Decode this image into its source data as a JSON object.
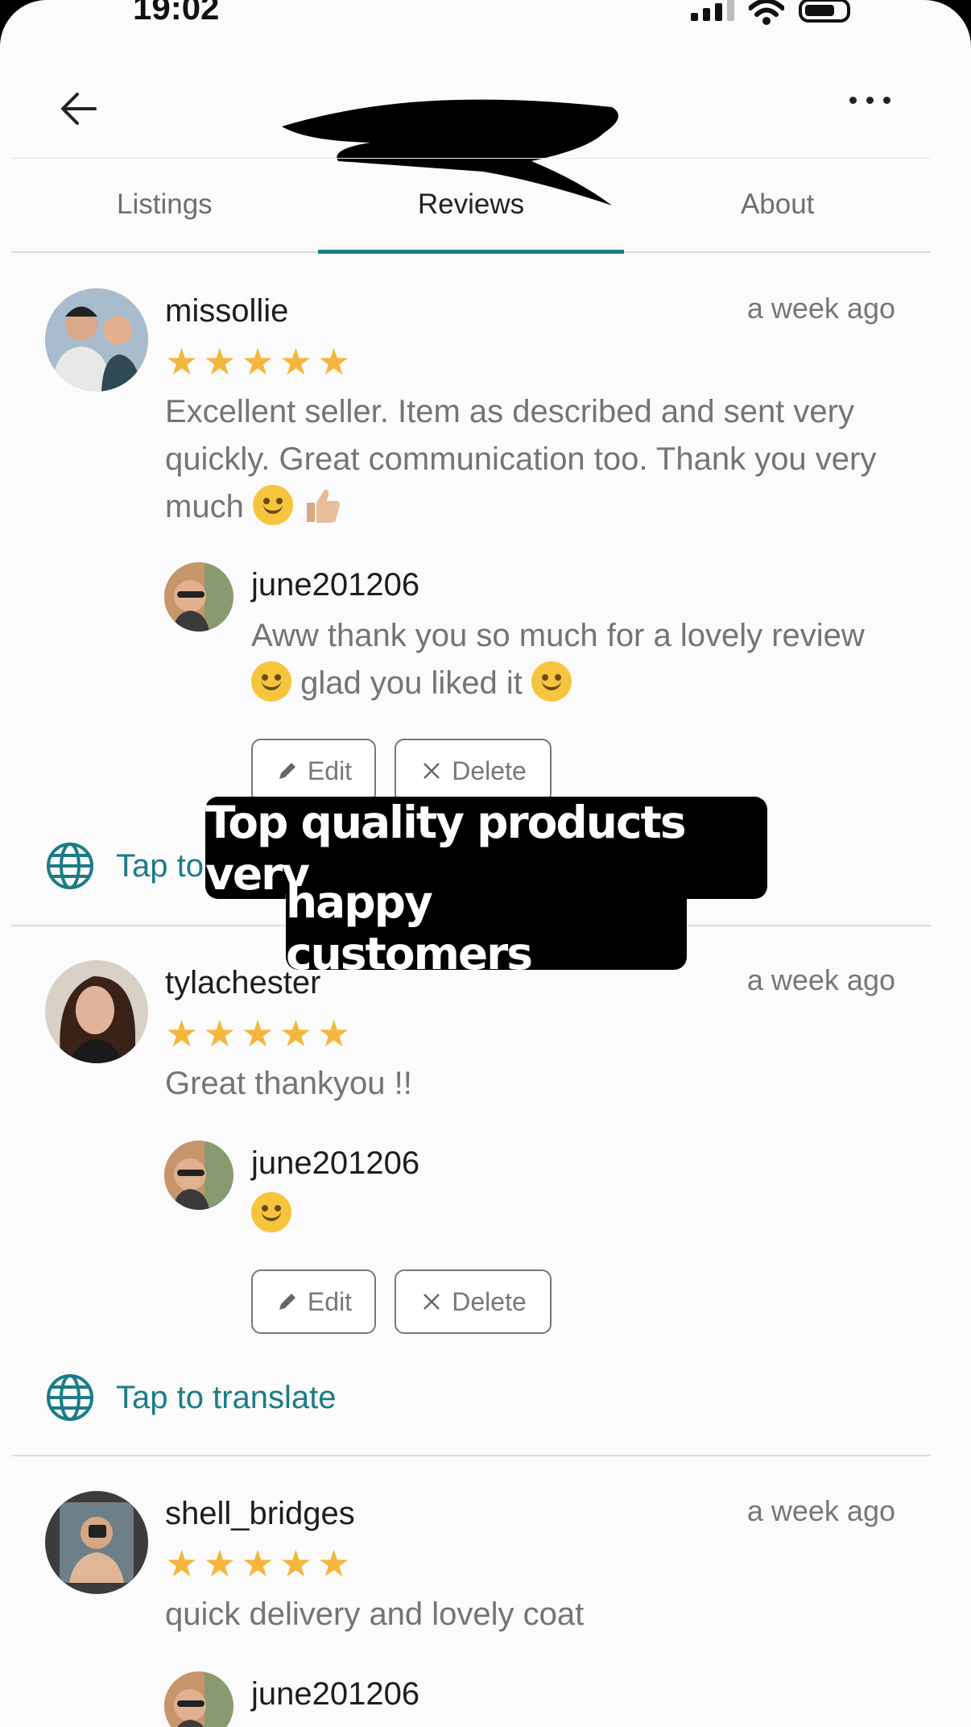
{
  "status": {
    "time": "19:02"
  },
  "tabs": [
    {
      "label": "Listings",
      "active": false
    },
    {
      "label": "Reviews",
      "active": true
    },
    {
      "label": "About",
      "active": false
    }
  ],
  "accent": "#1b7c86",
  "star_color": "#f4b63b",
  "reviews": [
    {
      "user": "missollie",
      "time": "a week ago",
      "rating": 5,
      "text": "Excellent seller. Item as described and sent very quickly. Great communication too. Thank you very much",
      "reply_user": "june201206",
      "reply_text_1": "Aww thank you so much for a lovely review",
      "reply_text_2": "glad you liked it"
    },
    {
      "user": "tylachester",
      "time": "a week ago",
      "rating": 5,
      "text": "Great thankyou !!",
      "reply_user": "june201206"
    },
    {
      "user": "shell_bridges",
      "time": "a week ago",
      "rating": 5,
      "text": "quick delivery and lovely coat",
      "reply_user": "june201206"
    }
  ],
  "actions": {
    "edit": "Edit",
    "delete": "Delete",
    "translate": "Tap to translate",
    "translate_partial": "Tap to"
  },
  "caption": {
    "line1": "Top quality products very",
    "line2": "happy customers"
  }
}
